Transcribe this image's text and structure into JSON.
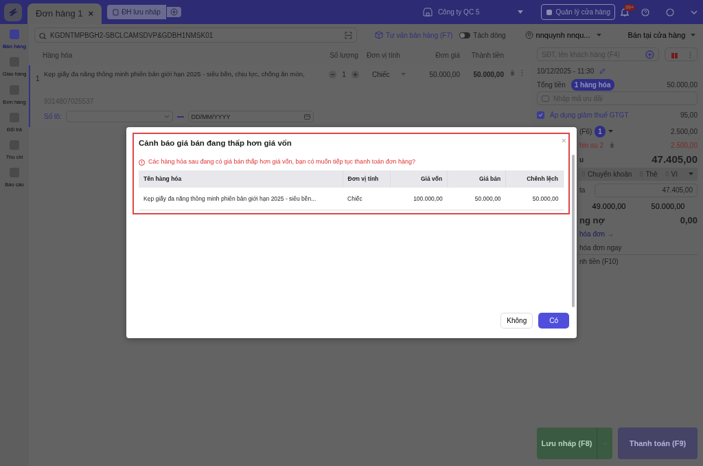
{
  "top_bar": {
    "tabs": [
      {
        "label": "Đơn hàng 1",
        "close": "×",
        "selected": true
      }
    ],
    "draft_button": "ĐH lưu nháp",
    "company": "Công ty QC 5",
    "store_button": "Quản lý cửa hàng",
    "notification_badge": "99+"
  },
  "sidebar": {
    "items": [
      {
        "label": "Bán hàng",
        "selected": true
      },
      {
        "label": "Giao hàng",
        "selected": false
      },
      {
        "label": "Đơn hàng",
        "selected": false
      },
      {
        "label": "Đổi trả",
        "selected": false
      },
      {
        "label": "Thu chi",
        "selected": false
      },
      {
        "label": "Báo cáo",
        "selected": false
      }
    ]
  },
  "toolbar": {
    "search": {
      "value": "KGDNTMPBGH2-SBCLCAMSDVP&GDBH1NMSK01"
    },
    "consult_link": "Tư vấn bán hàng (F7)",
    "split_toggle": {
      "label": "Tách dòng",
      "on": false
    },
    "user": "nnquynh nnqu...",
    "channel": "Bán tại cửa hàng"
  },
  "order_table": {
    "columns": [
      "Hàng hóa",
      "Số lượng",
      "Đơn vị tính",
      "Đơn giá",
      "Thành tiền"
    ],
    "rows": [
      {
        "index": "1",
        "name": "Kẹp giấy đa năng thông minh phiên bản giới hạn 2025 - siêu bền, chịu lực, chống ăn mòn,",
        "quantity": "1",
        "unit": "Chiếc",
        "price": "50.000,00",
        "total": "50.000,00",
        "barcode": "9314807025537",
        "lot_label": "Số lô:",
        "date_placeholder": "DD/MM/YYYY"
      }
    ]
  },
  "summary": {
    "customer_placeholder": "SĐT, tên khách hàng (F4)",
    "datetime": "10/12/2025 - 11:30",
    "total_label": "Tổng tiền",
    "item_count": "1 hàng hóa",
    "total": "50.000,00",
    "promo_placeholder": "Nhập mã ưu đãi",
    "vat": {
      "label": "Áp dụng giảm thuế GTGT",
      "checked": true,
      "value": "95,00"
    },
    "discount": {
      "label": "(F6)",
      "count": "1",
      "value": "2.500,00"
    },
    "promotion": {
      "label": "hin su 2",
      "value": "2.500,00"
    },
    "payable": {
      "label": "u",
      "value": "47.405,00"
    },
    "payment_methods": [
      {
        "label": "Chuyển khoản",
        "selected": false
      },
      {
        "label": "Thẻ",
        "selected": false
      },
      {
        "label": "Ví",
        "selected": false
      }
    ],
    "paid": {
      "label": "ta",
      "value": "47.405,00"
    },
    "quick_amounts": [
      "49.000,00",
      "50.000,00"
    ],
    "debt": {
      "label": "ng nợ",
      "value": "0,00"
    },
    "invoice_link": "hóa đơn →",
    "invoice_now": "hóa đơn ngay",
    "print": "nh tiền (F10)"
  },
  "actions": {
    "save_draft": "Lưu nháp (F8)",
    "pay": "Thanh toán (F9)"
  },
  "dialog": {
    "title": "Cảnh báo giá bán đang thấp hơn giá vốn",
    "close": "×",
    "message": "Các hàng hóa sau đang có giá bán thấp hơn giá vốn, bạn có muốn tiếp tục thanh toán đơn hàng?",
    "columns": [
      "Tên hàng hóa",
      "Đơn vị tính",
      "Giá vốn",
      "Giá bán",
      "Chênh lệch"
    ],
    "rows": [
      [
        "Kẹp giấy đa năng thông minh phiên bản giới hạn 2025 - siêu bền...",
        "Chiếc",
        "100.000,00",
        "50.000,00",
        "50.000,00"
      ]
    ],
    "buttons": [
      {
        "label": "Không",
        "kind": "secondary"
      },
      {
        "label": "Có",
        "kind": "primary"
      }
    ]
  }
}
